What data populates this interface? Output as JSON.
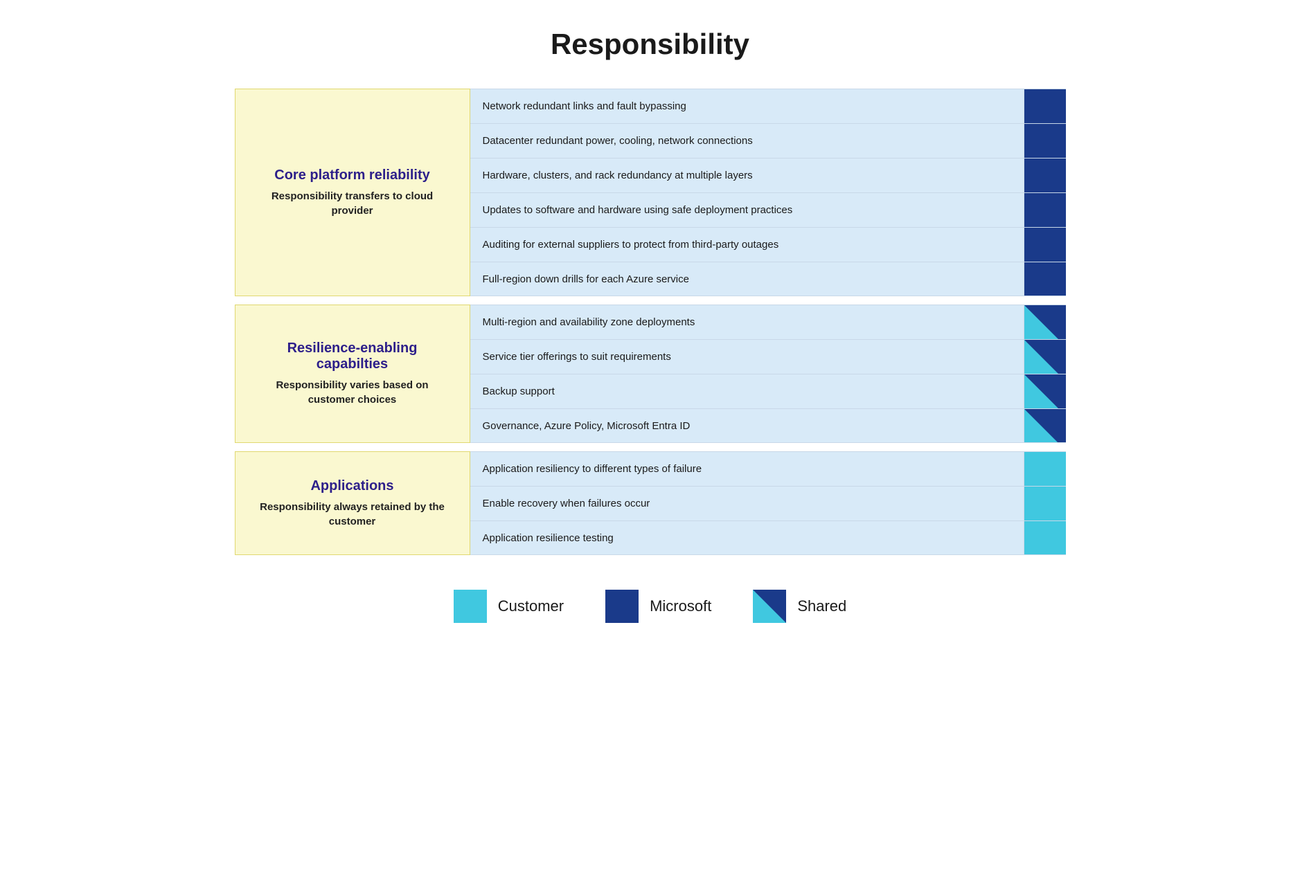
{
  "title": "Responsibility",
  "sections": [
    {
      "id": "core-platform",
      "heading": "Core platform reliability",
      "subtext": "Responsibility transfers\nto cloud provider",
      "items": [
        {
          "text": "Network redundant links and fault bypassing",
          "indicator": "microsoft"
        },
        {
          "text": "Datacenter redundant power, cooling, network connections",
          "indicator": "microsoft"
        },
        {
          "text": "Hardware, clusters, and rack redundancy at multiple layers",
          "indicator": "microsoft"
        },
        {
          "text": "Updates to software and hardware using safe deployment practices",
          "indicator": "microsoft"
        },
        {
          "text": "Auditing for external suppliers to protect from third-party outages",
          "indicator": "microsoft"
        },
        {
          "text": "Full-region down drills for each Azure service",
          "indicator": "microsoft"
        }
      ]
    },
    {
      "id": "resilience-enabling",
      "heading": "Resilience-enabling capabilties",
      "subtext": "Responsibility varies based\non customer choices",
      "items": [
        {
          "text": "Multi-region and availability zone deployments",
          "indicator": "shared"
        },
        {
          "text": "Service tier offerings to suit requirements",
          "indicator": "shared"
        },
        {
          "text": "Backup support",
          "indicator": "shared"
        },
        {
          "text": "Governance, Azure Policy, Microsoft Entra ID",
          "indicator": "shared"
        }
      ]
    },
    {
      "id": "applications",
      "heading": "Applications",
      "subtext": "Responsibility always\nretained by the customer",
      "items": [
        {
          "text": "Application resiliency to different types of failure",
          "indicator": "customer"
        },
        {
          "text": "Enable recovery when failures occur",
          "indicator": "customer"
        },
        {
          "text": "Application resilience testing",
          "indicator": "customer"
        }
      ]
    }
  ],
  "legend": [
    {
      "id": "customer",
      "label": "Customer",
      "type": "customer"
    },
    {
      "id": "microsoft",
      "label": "Microsoft",
      "type": "microsoft"
    },
    {
      "id": "shared",
      "label": "Shared",
      "type": "shared"
    }
  ]
}
